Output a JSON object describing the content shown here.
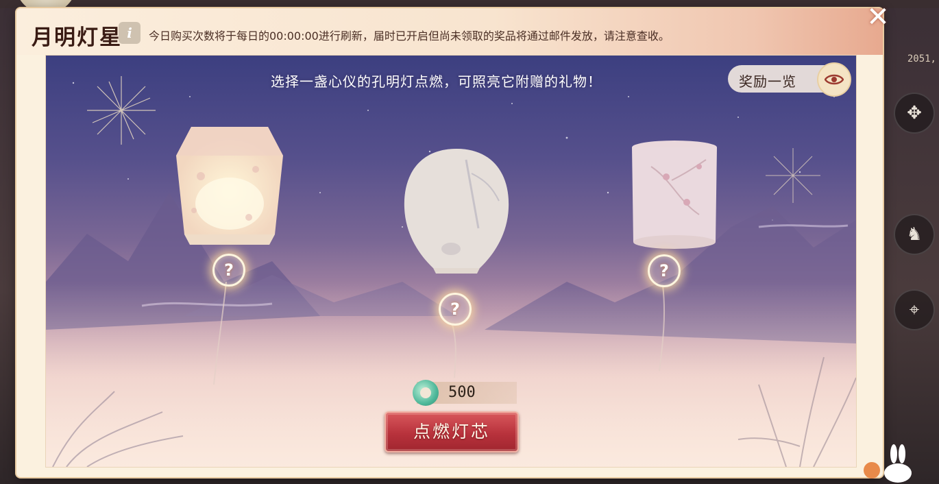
{
  "window": {
    "title": "月明灯星",
    "notice": "今日购买次数将于每日的00:00:00进行刷新，届时已开启但尚未领取的奖品将通过邮件发放，请注意查收。"
  },
  "scene": {
    "hint": "选择一盏心仪的孔明灯点燃，可照亮它附赠的礼物！",
    "reward_button_label": "奖励一览",
    "mystery_symbol": "?"
  },
  "lanterns": [
    {
      "style": "floral-trapezoid",
      "reward": "?"
    },
    {
      "style": "bamboo-round",
      "reward": "?"
    },
    {
      "style": "plum-cylinder",
      "reward": "?"
    }
  ],
  "cost": {
    "currency_icon": "jade-currency-icon",
    "amount": "500"
  },
  "action": {
    "label": "点燃灯芯"
  },
  "background": {
    "coordinate_readout": "2051,"
  },
  "icons": {
    "close": "close-icon",
    "info": "info-icon",
    "eye": "eye-icon"
  },
  "colors": {
    "accent": "#b8323c",
    "panel": "#fbf1df",
    "sky_top": "#3c3f80",
    "title": "#3a1c14"
  }
}
